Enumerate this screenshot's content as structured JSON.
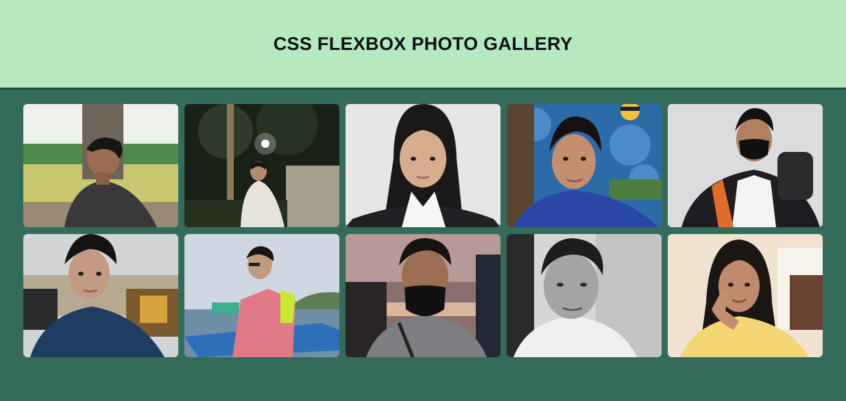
{
  "header": {
    "title": "CSS FLEXBOX PHOTO GALLERY"
  },
  "colors": {
    "header_bg": "#b5eac1",
    "page_bg": "#346b5a",
    "divider": "#1f4a3d"
  },
  "gallery": {
    "photos": [
      {
        "icon": "portrait-outdoor-field"
      },
      {
        "icon": "portrait-night-park"
      },
      {
        "icon": "portrait-white-wall"
      },
      {
        "icon": "portrait-cartoon-sky"
      },
      {
        "icon": "portrait-masked-jacket"
      },
      {
        "icon": "portrait-indoor-ceiling"
      },
      {
        "icon": "portrait-beach-boat"
      },
      {
        "icon": "portrait-masked-sunset"
      },
      {
        "icon": "portrait-black-and-white"
      },
      {
        "icon": "portrait-peace-sign"
      }
    ]
  }
}
